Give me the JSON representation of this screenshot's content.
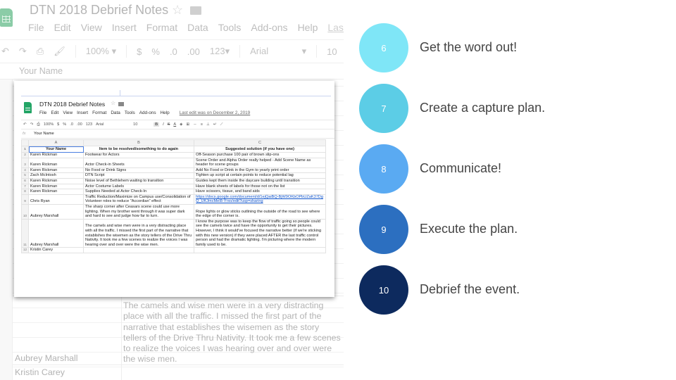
{
  "background_app": {
    "title": "DTN 2018 Debrief Notes",
    "menu": [
      "File",
      "Edit",
      "View",
      "Insert",
      "Format",
      "Data",
      "Tools",
      "Add-ons",
      "Help"
    ],
    "menu_last": "Last e",
    "toolbar": {
      "zoom": "100%",
      "currency": "$",
      "percent": "%",
      "decrease_decimal": ".0",
      "increase_decimal": ".00",
      "number_format": "123",
      "font": "Arial",
      "font_size": "10"
    },
    "formula_value": "Your Name",
    "cell_text": "The camels and wise men were in a very distracting place with all the traffic.  I missed the first part of the narrative that establishes the wisemen as the story tellers of the Drive Thru Nativity.  It took me a few scenes to realize the voices I was hearing over and over were the wise men.",
    "name_1": "Aubrey Marshall",
    "name_2": "Kristin Carey"
  },
  "screenshot": {
    "title": "DTN 2018 Debrief Notes",
    "menu": [
      "File",
      "Edit",
      "View",
      "Insert",
      "Format",
      "Data",
      "Tools",
      "Add-ons",
      "Help"
    ],
    "last_edit": "Last edit was on December 2, 2019",
    "toolbar": {
      "zoom": "100%",
      "currency": "$",
      "percent": "%",
      "decrease_decimal": ".0",
      "increase_decimal": ".00",
      "number_format": "123",
      "font": "Arial",
      "font_size": "10",
      "bold": "B",
      "italic": "I",
      "strike": "S",
      "text_color": "A"
    },
    "formula_value": "Your Name",
    "columns": [
      "A",
      "B",
      "C"
    ],
    "rows": [
      {
        "n": "1",
        "a": "Your Name",
        "b": "Item to be resolved/something to do again",
        "c": "Suggested solution (if you have one)"
      },
      {
        "n": "2",
        "a": "Karen Rickman",
        "b": "Footwear for Actors",
        "c": "Off-Season purchase 100 pair of brown slip-ons"
      },
      {
        "n": "3",
        "a": "Karen Rickman",
        "b": "Actor Check-in Sheets",
        "c": "Scene Order and Alpha Order really helped - Add Scene Name as header for scene groups"
      },
      {
        "n": "4",
        "a": "Karen Rickman",
        "b": "No Food or Drink Signs",
        "c": "Add No Food or Drink in the Gym to yearly print order"
      },
      {
        "n": "5",
        "a": "Zach McIntosh",
        "b": "DTN Script",
        "c": "Tighten up script at certain points to reduce potential lag"
      },
      {
        "n": "6",
        "a": "Karen Rickman",
        "b": "Noise level of Bethlehem waiting to transition",
        "c": "Guides kept them inside the daycare building until transition"
      },
      {
        "n": "7",
        "a": "Karen Rickman",
        "b": "Actor Costume Labels",
        "c": "Have blank sheets of labels for those not on the list"
      },
      {
        "n": "8",
        "a": "Karen Rickman",
        "b": "Supplies Needed at Actor Check-In",
        "c": "Have scissors, tissue, and band aids"
      },
      {
        "n": "9",
        "a": "Chris Ryan",
        "b": "Traffic Reduction/Maximize on Campus use/Consolidation of Volunteer roles to reduce \"Accordian\" effect",
        "c": "https://docs.google.com/document/d/1ejQaiBQ-BjW9OKbOPbUZaK37DgQ_UKJmcMeI8-Yrxo/edit?usp=sharing"
      },
      {
        "n": "10",
        "a": "Aubrey Marshall",
        "b": "The sharp corner after Ceasars scene could use more lighting.  When my brother went through it was super dark and hard to see and judge how far to turn.",
        "c": "Rope lights or glow sticks outlining the outside of the road to see where the edge of the corner is."
      },
      {
        "n": "11",
        "a": "Aubrey Marshall",
        "b": "The camels and wise men were in a very distracting place with all the traffic.  I missed the first part of the narrative that establishes the wisemen as the story tellers of the Drive Thru Nativity.  It took me a few scenes to realize the voices I was hearing over and over were the wise men.",
        "c": "I know the purpose was to keep the flow of traffic going so people could see the camels twice and have the opportunity to get their pictures.  However, I think it would've focused the narrative better (if we're sticking with this new version) if they were placed AFTER the last traffic control person and had the dramatic lighting.  I'm picturing where the modern family used to be."
      },
      {
        "n": "12",
        "a": "Kristin Carey",
        "b": "",
        "c": ""
      }
    ]
  },
  "steps": [
    {
      "number": "6",
      "label": "Get the word out!",
      "color": "#7fe6f7"
    },
    {
      "number": "7",
      "label": "Create a capture plan.",
      "color": "#5ccde6"
    },
    {
      "number": "8",
      "label": "Communicate!",
      "color": "#5aaaf2"
    },
    {
      "number": "9",
      "label": "Execute the plan.",
      "color": "#2c6fc0"
    },
    {
      "number": "10",
      "label": "Debrief the event.",
      "color": "#0d2a5e"
    }
  ],
  "icons": [
    "sheets-logo-icon",
    "star-icon",
    "folder-icon",
    "undo-icon",
    "redo-icon",
    "print-icon",
    "paint-format-icon",
    "chevron-down-icon",
    "fx-icon"
  ]
}
